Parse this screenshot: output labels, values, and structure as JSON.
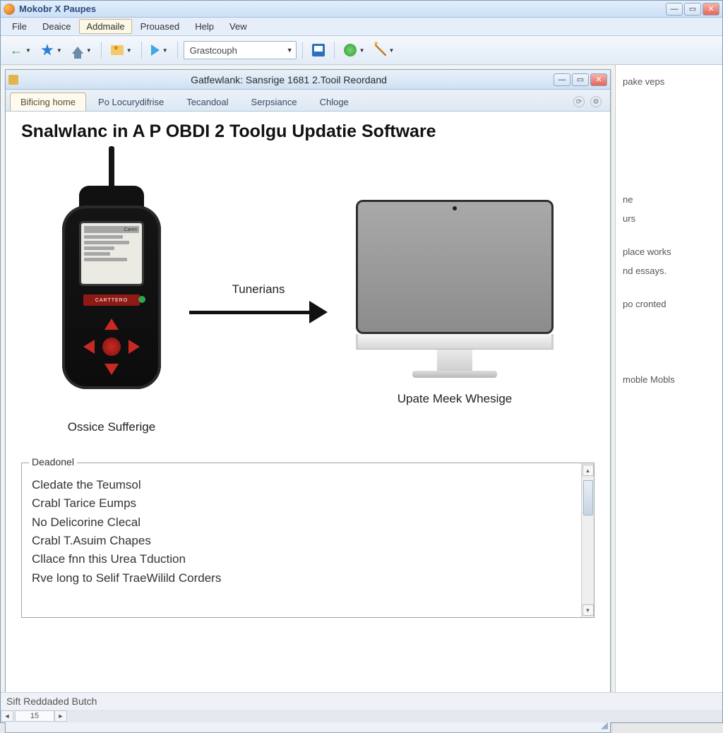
{
  "app": {
    "title": "Mokobr X Paupes"
  },
  "menu": {
    "file": "File",
    "device": "Deaice",
    "advanced": "Addmaile",
    "processed": "Prouased",
    "help": "Help",
    "view": "Vew"
  },
  "toolbar": {
    "combo_value": "Grastcouph"
  },
  "doc": {
    "title": "Gatfewlank: Sansrige 1681 2.Tooil Reordand",
    "tabs": [
      "Bificing home",
      "Po Locurydifrise",
      "Tecandoal",
      "Serpsiance",
      "Chloge"
    ],
    "heading": "Snalwlanc in A P OBDI 2 Toolgu Updatie Software",
    "arrow_label": "Tunerians",
    "obd": {
      "brand": "CARTTERO",
      "screen_tag": "Canm",
      "label": "Ossice Sufferige"
    },
    "monitor_label": "Upate Meek Whesige",
    "log": {
      "legend": "Deadonel",
      "lines": [
        "Cledate the Teumsol",
        "Crabl Tarice Eumps",
        "No Delicorine Clecal",
        "Crabl T.Asuim Chapes",
        "Cllace fnn this Urea Tduction",
        "Rve long to Selif TraeWilild Corders"
      ]
    }
  },
  "side": {
    "item1": "pake veps",
    "item2": "ne",
    "item3": "urs",
    "item4": "place works",
    "item5": "nd essays.",
    "item6": "po cronted",
    "item7": "moble Mobls"
  },
  "footer": {
    "status": "Sift Reddaded Butch",
    "tab_stub": "15"
  }
}
